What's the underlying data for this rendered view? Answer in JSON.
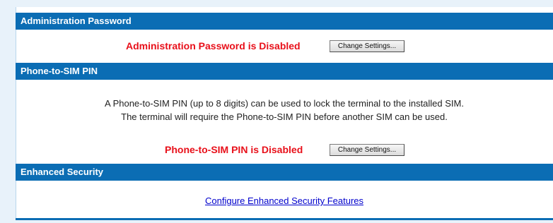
{
  "sections": {
    "admin_password": {
      "title": "Administration Password",
      "status": "Administration Password is Disabled",
      "button_label": "Change Settings..."
    },
    "phone_to_sim_pin": {
      "title": "Phone-to-SIM PIN",
      "description_line1": "A Phone-to-SIM PIN (up to 8 digits) can be used to lock the terminal to the installed SIM.",
      "description_line2": "The terminal will require the Phone-to-SIM PIN before another SIM can be used.",
      "status": "Phone-to-SIM PIN is Disabled",
      "button_label": "Change Settings..."
    },
    "enhanced_security": {
      "title": "Enhanced Security",
      "link_label": "Configure Enhanced Security Features"
    }
  },
  "colors": {
    "header_bg": "#0b6db4",
    "header_text": "#ffffff",
    "status_text": "#e8101a",
    "link": "#0000cc",
    "page_bg": "#e8f2fa"
  }
}
